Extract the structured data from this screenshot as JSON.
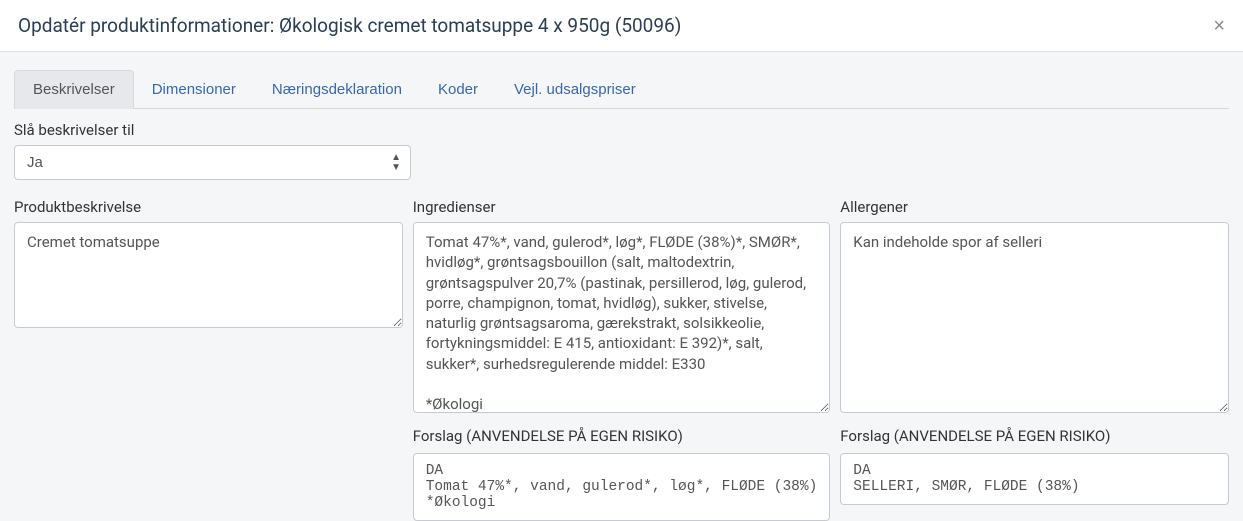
{
  "header": {
    "title": "Opdatér produktinformationer: Økologisk cremet tomatsuppe 4 x 950g (50096)",
    "close": "×"
  },
  "tabs": [
    {
      "label": "Beskrivelser",
      "active": true
    },
    {
      "label": "Dimensioner",
      "active": false
    },
    {
      "label": "Næringsdeklaration",
      "active": false
    },
    {
      "label": "Koder",
      "active": false
    },
    {
      "label": "Vejl. udsalgspriser",
      "active": false
    }
  ],
  "toggle": {
    "label": "Slå beskrivelser til",
    "value": "Ja"
  },
  "fields": {
    "description": {
      "label": "Produktbeskrivelse",
      "value": "Cremet tomatsuppe"
    },
    "ingredients": {
      "label": "Ingredienser",
      "value": "Tomat 47%*, vand, gulerod*, løg*, FLØDE (38%)*, SMØR*, hvidløg*, grøntsagsbouillon (salt, maltodextrin, grøntsagspulver 20,7% (pastinak, persillerod, løg, gulerod, porre, champignon, tomat, hvidløg), sukker, stivelse, naturlig grøntsagsaroma, gærekstrakt, solsikkeolie, fortykningsmiddel: E 415, antioxidant: E 392)*, salt, sukker*, surhedsregulerende middel: E330\n\n*Økologi"
    },
    "allergens": {
      "label": "Allergener",
      "value": "Kan indeholde spor af selleri"
    }
  },
  "suggestions": {
    "ingredients": {
      "label": "Forslag (ANVENDELSE PÅ EGEN RISIKO)",
      "lines": {
        "l1": "DA",
        "l2": "Tomat 47%*, vand, gulerod*, løg*, FLØDE (38%)",
        "l3": "*Økologi"
      }
    },
    "allergens": {
      "label": "Forslag (ANVENDELSE PÅ EGEN RISIKO)",
      "lines": {
        "l1": "DA",
        "l2": "SELLERI, SMØR, FLØDE (38%)"
      }
    }
  }
}
